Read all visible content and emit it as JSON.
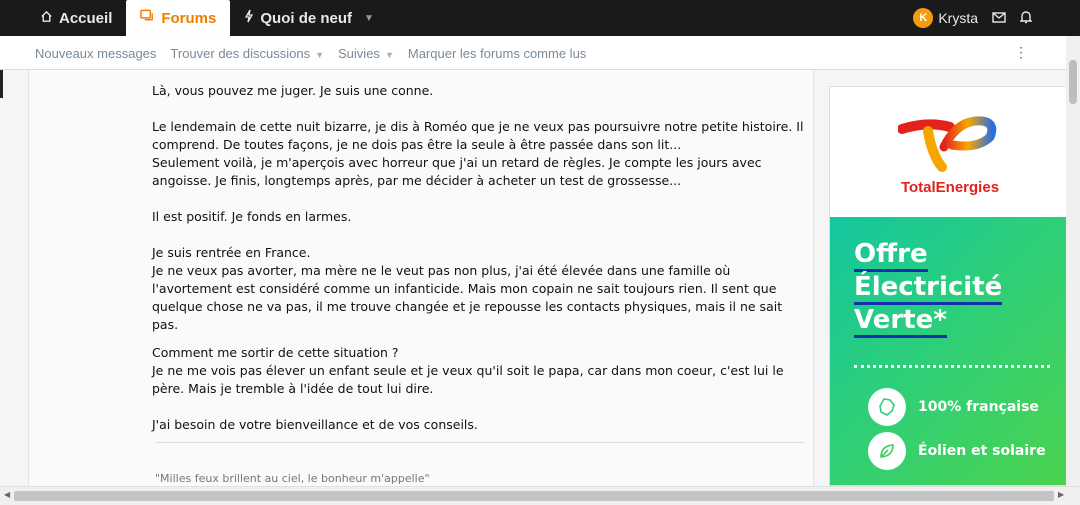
{
  "topnav": {
    "tabs": [
      {
        "label": "Accueil",
        "icon": "home-icon"
      },
      {
        "label": "Forums",
        "icon": "forums-icon"
      },
      {
        "label": "Quoi de neuf",
        "icon": "bolt-icon"
      }
    ],
    "user": {
      "initial": "K",
      "name": "Krysta"
    },
    "accent_color": "#f07c00"
  },
  "subnav": {
    "links": [
      "Nouveaux messages",
      "Trouver des discussions",
      "Suivies",
      "Marquer les forums comme lus"
    ]
  },
  "post": {
    "paragraphs": [
      "Là, vous pouvez me juger. Je suis une conne.",
      "Le lendemain de cette nuit bizarre, je dis à Roméo que je ne veux pas poursuivre notre petite histoire. Il comprend. De toutes façons, je ne dois pas être la seule à être passée dans son lit...\nSeulement voilà, je m'aperçois avec horreur que j'ai un retard de règles. Je compte les jours avec angoisse. Je finis, longtemps après, par me décider à acheter un test de grossesse...",
      "Il est positif. Je fonds en larmes.",
      "Je suis rentrée en France.\nJe ne veux pas avorter, ma mère ne le veut pas non plus, j'ai été élevée dans une famille où l'avortement est considéré comme un infanticide. Mais mon copain ne sait toujours rien. Il sent que quelque chose ne va pas, il me trouve changée et je repousse les contacts physiques, mais il ne sait pas.",
      "Comment me sortir de cette situation ?\nJe ne me vois pas élever un enfant seule et je veux qu'il soit le papa, car dans mon coeur, c'est lui le père. Mais je tremble à l'idée de tout lui dire.",
      "J'ai besoin de votre bienveillance et de vos conseils."
    ],
    "signature": "\"Milles feux brillent au ciel, le bonheur m'appelle\""
  },
  "ad": {
    "brand": "TotalEnergies",
    "headline": [
      "Offre",
      "Électricité",
      "Verte*"
    ],
    "features": [
      {
        "label": "100% française",
        "icon": "france-map-icon"
      },
      {
        "label": "Éolien et solaire",
        "icon": "leaf-icon"
      }
    ]
  }
}
